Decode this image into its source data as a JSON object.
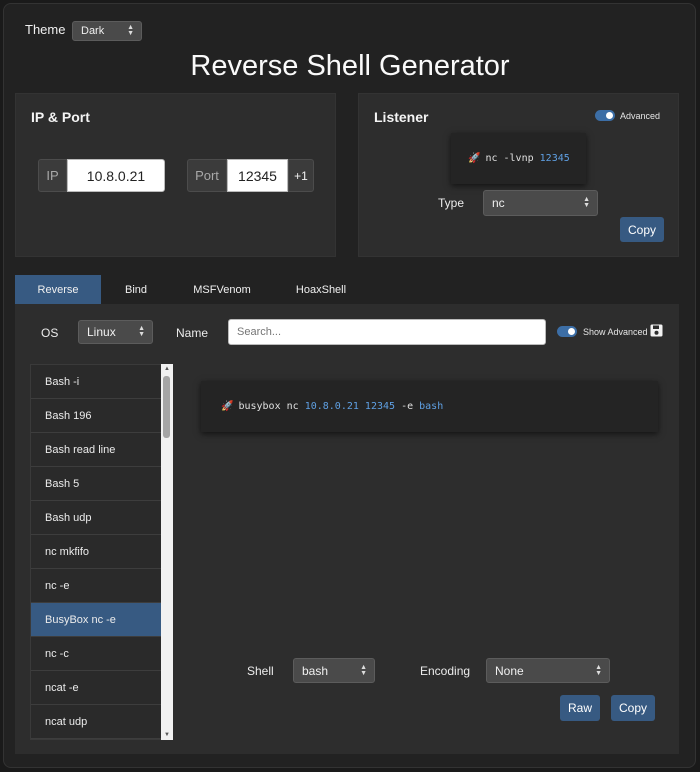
{
  "theme": {
    "label": "Theme",
    "value": "Dark"
  },
  "title": "Reverse Shell Generator",
  "ip_port": {
    "title": "IP & Port",
    "ip_label": "IP",
    "ip_value": "10.8.0.21",
    "port_label": "Port",
    "port_value": "12345",
    "increment_label": "+1"
  },
  "listener": {
    "title": "Listener",
    "advanced_label": "Advanced",
    "advanced_enabled": true,
    "command_prefix": "nc -lvnp",
    "command_port": "12345",
    "type_label": "Type",
    "type_value": "nc",
    "copy_label": "Copy"
  },
  "tabs": [
    {
      "label": "Reverse",
      "active": true
    },
    {
      "label": "Bind",
      "active": false
    },
    {
      "label": "MSFVenom",
      "active": false
    },
    {
      "label": "HoaxShell",
      "active": false
    }
  ],
  "filters": {
    "os_label": "OS",
    "os_value": "Linux",
    "name_label": "Name",
    "search_placeholder": "Search...",
    "show_advanced_label": "Show Advanced",
    "show_advanced_enabled": true
  },
  "shell_list": [
    "Bash -i",
    "Bash 196",
    "Bash read line",
    "Bash 5",
    "Bash udp",
    "nc mkfifo",
    "nc -e",
    "BusyBox nc -e",
    "nc -c",
    "ncat -e",
    "ncat udp"
  ],
  "selected_shell": "BusyBox nc -e",
  "payload": {
    "prefix": "busybox nc",
    "ip": "10.8.0.21",
    "port": "12345",
    "flag": "-e",
    "shell": "bash"
  },
  "options": {
    "shell_label": "Shell",
    "shell_value": "bash",
    "encoding_label": "Encoding",
    "encoding_value": "None",
    "raw_label": "Raw",
    "copy_label": "Copy"
  },
  "colors": {
    "accent": "#375a82",
    "highlight": "#5fa0e3",
    "background": "#222222",
    "card": "#2d2d2d"
  },
  "icons": {
    "rocket": "rocket-icon",
    "save": "save-icon"
  }
}
